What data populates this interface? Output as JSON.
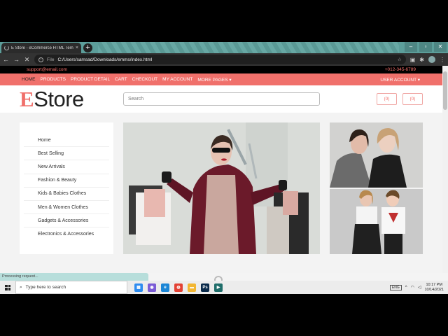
{
  "browser": {
    "tab_title": "E Store - eCommerce HTML Tem",
    "tab_close": "×",
    "new_tab": "+",
    "url_scheme": "File",
    "url": "C:/Users/samsad/Downloads/emms/index.html",
    "status_text": "Processing request..."
  },
  "site": {
    "email": "support@email.com",
    "phone": "+012-345-6789",
    "nav": [
      "HOME",
      "PRODUCTS",
      "PRODUCT DETAIL",
      "CART",
      "CHECKOUT",
      "MY ACCOUNT",
      "MORE PAGES ▾"
    ],
    "user_account": "USER ACCOUNT ▾",
    "logo_initial": "E",
    "logo_rest": "Store",
    "search_placeholder": "Search",
    "wishlist_count": "(0)",
    "cart_count": "(0)",
    "categories": [
      "Home",
      "Best Selling",
      "New Arrivals",
      "Fashion & Beauty",
      "Kids & Babies Clothes",
      "Men & Women Clothes",
      "Gadgets & Accessories",
      "Electronics & Accessories"
    ]
  },
  "taskbar": {
    "search_placeholder": "Type here to search",
    "time": "10:17 PM",
    "date": "10/14/2021",
    "keyboard": "ENG"
  },
  "colors": {
    "accent": "#f0706b",
    "topbar": "#000000",
    "chrome_tab_strip": "#5c9e9a"
  }
}
